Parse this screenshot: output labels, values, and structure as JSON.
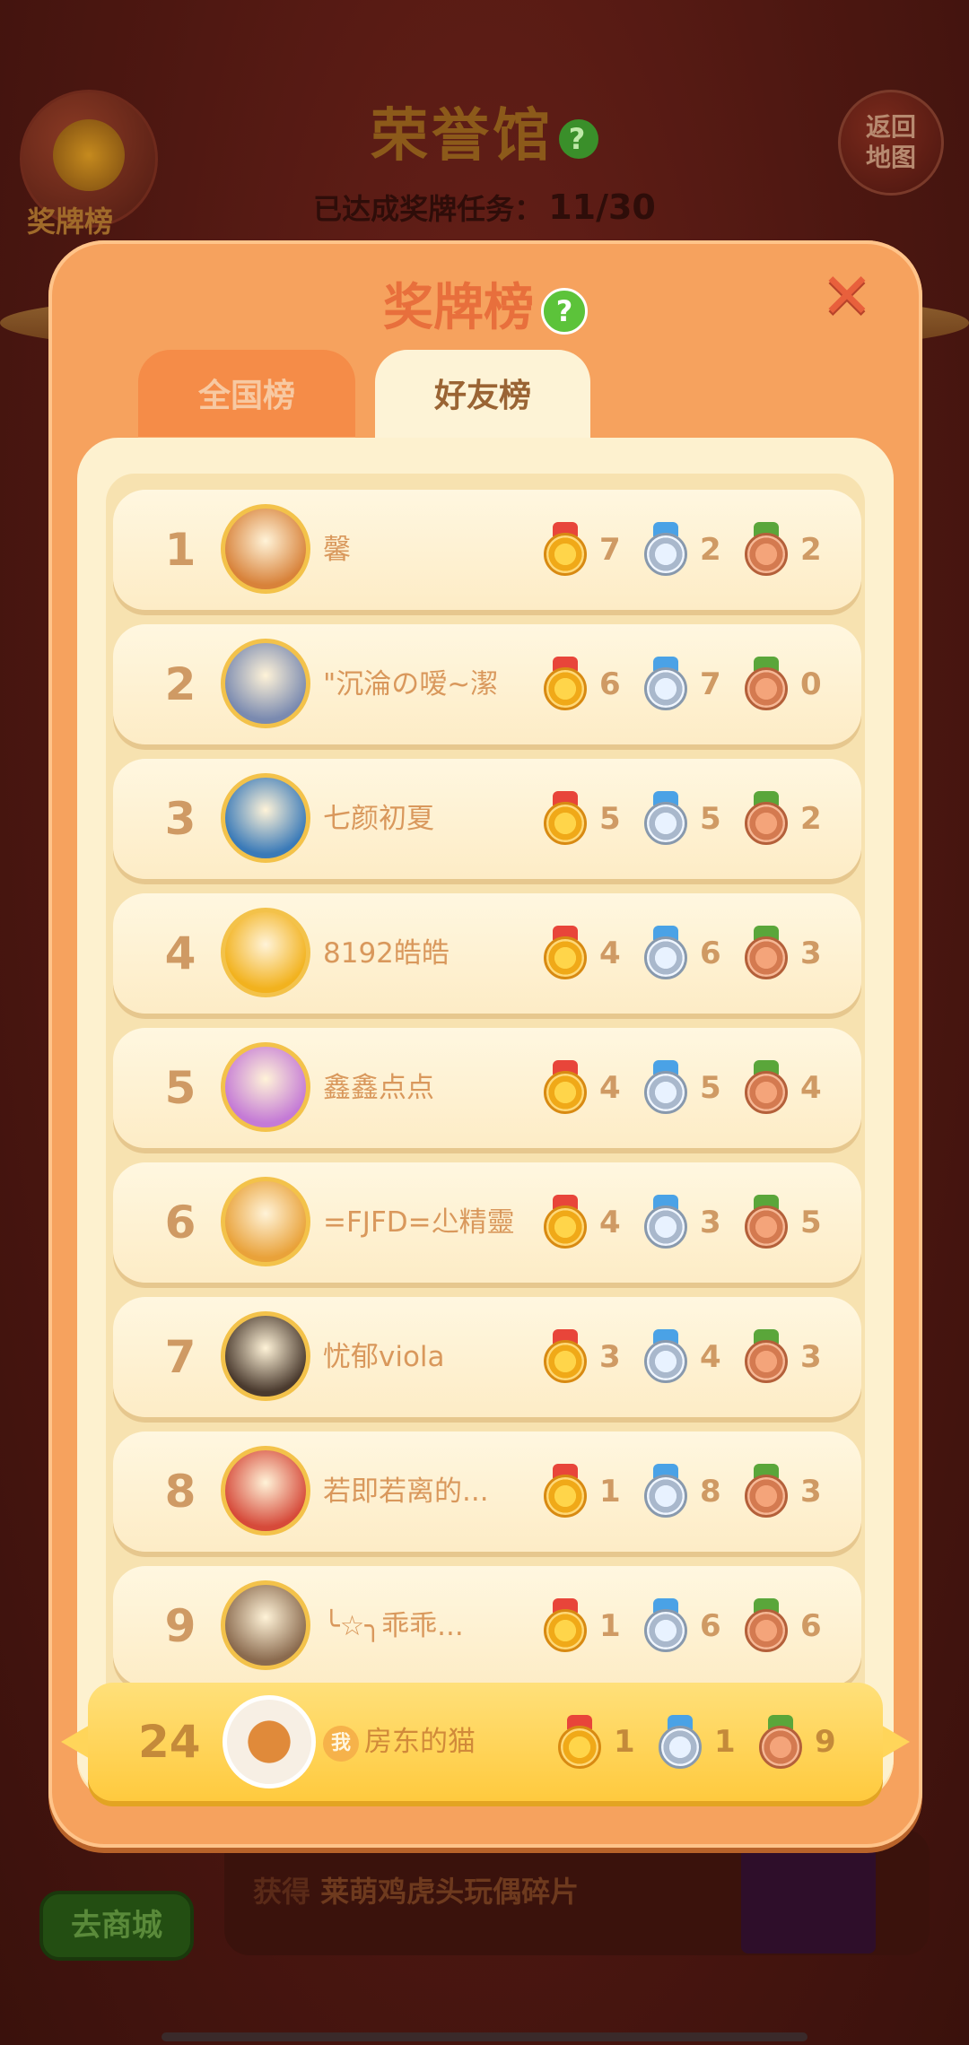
{
  "background": {
    "title": "荣誉馆",
    "title_help_icon": "?",
    "progress_label": "已达成奖牌任务：",
    "progress_value": "11/30",
    "medal_board_label": "奖牌榜",
    "return_button": "返回地图",
    "shop_button": "去商城",
    "reward_prefix": "获得",
    "reward_item": "莱萌鸡虎头玩偶碎片"
  },
  "modal": {
    "title": "奖牌榜",
    "help_icon": "?",
    "close_icon": "✕",
    "tabs": [
      {
        "label": "全国榜",
        "active": false
      },
      {
        "label": "好友榜",
        "active": true
      }
    ]
  },
  "leaderboard": [
    {
      "rank": "1",
      "name": "馨",
      "gold": "7",
      "silver": "2",
      "bronze": "2",
      "avatar_color": "#d8823a"
    },
    {
      "rank": "2",
      "name": "\"沉淪の嗳~潔",
      "gold": "6",
      "silver": "7",
      "bronze": "0",
      "avatar_color": "#7a8ab0"
    },
    {
      "rank": "3",
      "name": "七颜初夏",
      "gold": "5",
      "silver": "5",
      "bronze": "2",
      "avatar_color": "#3a7ab8"
    },
    {
      "rank": "4",
      "name": "8192皓皓",
      "gold": "4",
      "silver": "6",
      "bronze": "3",
      "avatar_color": "#f2b21e"
    },
    {
      "rank": "5",
      "name": "鑫鑫点点",
      "gold": "4",
      "silver": "5",
      "bronze": "4",
      "avatar_color": "#c47ad6"
    },
    {
      "rank": "6",
      "name": "=FJFD=尐精靈",
      "gold": "4",
      "silver": "3",
      "bronze": "5",
      "avatar_color": "#e9a23a"
    },
    {
      "rank": "7",
      "name": "忧郁viola",
      "gold": "3",
      "silver": "4",
      "bronze": "3",
      "avatar_color": "#4a3a2e"
    },
    {
      "rank": "8",
      "name": "若即若离的...",
      "gold": "1",
      "silver": "8",
      "bronze": "3",
      "avatar_color": "#d64a3a"
    },
    {
      "rank": "9",
      "name": "╰☆╮乖乖...",
      "gold": "1",
      "silver": "6",
      "bronze": "6",
      "avatar_color": "#8a6a4e"
    }
  ],
  "self": {
    "rank": "24",
    "me_badge": "我",
    "name": "房东的猫",
    "gold": "1",
    "silver": "1",
    "bronze": "9"
  }
}
